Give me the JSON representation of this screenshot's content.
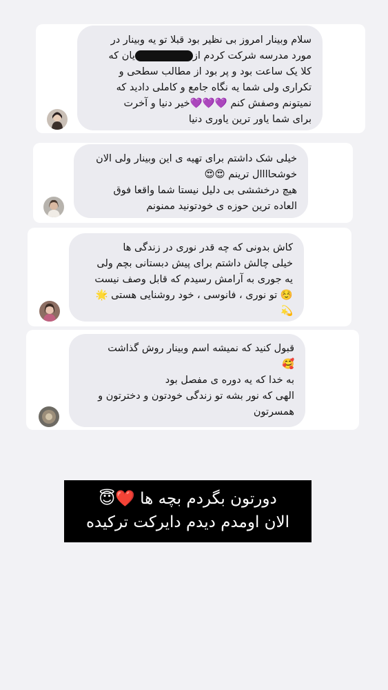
{
  "comments": [
    {
      "lines": [
        "سلام وبینار امروز بی نظیر بود قبلا تو یه وبینار در",
        "مورد مدرسه شرکت کردم از",
        "کلا یک ساعت بود و پر بود از مطالب سطحی و",
        "تکراری ولی شما یه نگاه جامع و کاملی دادید که",
        "نمیتونم وصفش کنم 💜💜💜خیر دنیا و آخرت",
        "برای شما یاور ترین یاوری دنیا"
      ],
      "line2_suffix": "یان که"
    },
    {
      "lines": [
        "خیلی شک داشتم برای تهیه ی این وبینار ولی الان",
        "خوشحاااال ترینم 😍😍",
        "هیچ درخششی بی دلیل نیستا  شما واقعا فوق",
        "العاده ترین حوزه ی خودتونید ممنونم"
      ]
    },
    {
      "lines": [
        "کاش بدونی که چه قدر نوری در زندگی ها",
        "خیلی چالش داشتم برای پیش دبستانی بچم ولی",
        "یه جوری به آرامش رسیدم که قابل وصف نیست",
        "☺️ تو نوری ، فانوسی ، خود روشنایی هستی 🌟",
        "💫"
      ]
    },
    {
      "lines": [
        "قبول کنید که نمیشه اسم وبینار روش گذاشت",
        "🥰",
        "به خدا که یه دوره ی مفصل بود",
        "الهی که نور بشه تو زندگی خودتون و دخترتون و",
        "همسرتون"
      ]
    }
  ],
  "banner": {
    "line1": "دورتون بگردم بچه ها ❤️😇",
    "line2": "الان اومدم دیدم دایرکت ترکیده"
  }
}
